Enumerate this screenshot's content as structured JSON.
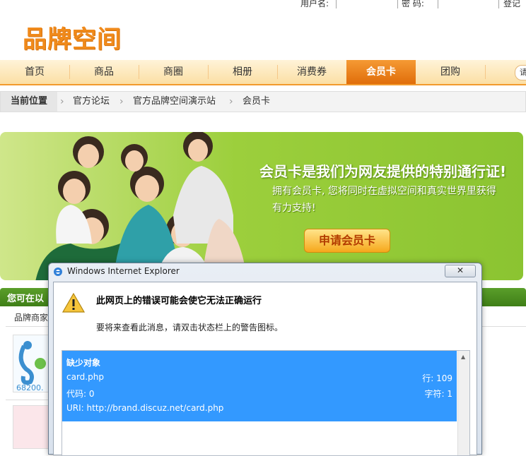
{
  "login": {
    "username_label": "用户名:",
    "password_label": "密 码:",
    "signup_label": "登记时"
  },
  "logo": {
    "text": "品牌空间"
  },
  "nav": {
    "items": [
      {
        "label": "首页"
      },
      {
        "label": "商品"
      },
      {
        "label": "商圈"
      },
      {
        "label": "相册"
      },
      {
        "label": "消费券"
      },
      {
        "label": "会员卡",
        "active": true
      },
      {
        "label": "团购"
      }
    ],
    "search_placeholder": "请"
  },
  "breadcrumb": {
    "current_label": "当前位置",
    "items": [
      "官方论坛",
      "官方品牌空间演示站",
      "会员卡"
    ]
  },
  "banner": {
    "headline": "会员卡是我们为网友提供的特别通行证!",
    "body": "拥有会员卡, 您将同时在虚拟空间和真实世界里获得有力支持!",
    "apply_button": "申请会员卡"
  },
  "section": {
    "title": "您可在以",
    "tab": "品牌商家"
  },
  "dialog": {
    "window_title": "Windows Internet Explorer",
    "close_label": "✕",
    "heading": "此网页上的错误可能会使它无法正确运行",
    "subtext": "要将来查看此消息，请双击状态栏上的警告图标。",
    "error": {
      "title": "缺少对象",
      "file": "card.php",
      "line_label": "行: 109",
      "code_label": "代码: 0",
      "char_label": "字符: 1",
      "uri": "URI: http://brand.discuz.net/card.php"
    }
  },
  "colors": {
    "nav_active": "#e06d0a",
    "banner_green": "#8bc431",
    "selection_blue": "#3399ff"
  }
}
